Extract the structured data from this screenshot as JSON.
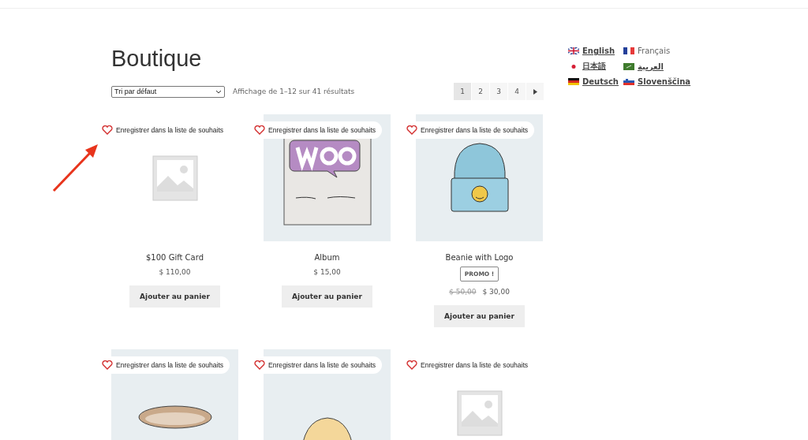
{
  "page_title": "Boutique",
  "sort": {
    "value": "Tri par défaut"
  },
  "result_count": "Affichage de 1–12 sur 41 résultats",
  "pagination": [
    {
      "label": "1",
      "selected": true
    },
    {
      "label": "2",
      "selected": false
    },
    {
      "label": "3",
      "selected": false
    },
    {
      "label": "4",
      "selected": false
    }
  ],
  "languages": [
    {
      "label": "English",
      "kind": "uk",
      "selected": false
    },
    {
      "label": "Français",
      "kind": "fr",
      "selected": true
    },
    {
      "label": "日本語",
      "kind": "jp",
      "selected": false
    },
    {
      "label": "العربية",
      "kind": "sa",
      "selected": false
    },
    {
      "label": "Deutsch",
      "kind": "de",
      "selected": false
    },
    {
      "label": "Slovenščina",
      "kind": "si",
      "selected": false
    }
  ],
  "products": [
    {
      "wishlist": "Enregistrer dans la liste de souhaits",
      "kind": "placeholder",
      "name": "$100 Gift Card",
      "price": "$ 110,00",
      "button": "Ajouter au panier"
    },
    {
      "wishlist": "Enregistrer dans la liste de souhaits",
      "kind": "album",
      "name": "Album",
      "price": "$ 15,00",
      "button": "Ajouter au panier"
    },
    {
      "wishlist": "Enregistrer dans la liste de souhaits",
      "kind": "beanie",
      "name": "Beanie with Logo",
      "badge": "PROMO !",
      "old_price": "$ 50,00",
      "price": "$ 30,00",
      "button": "Ajouter au panier"
    },
    {
      "wishlist": "Enregistrer dans la liste de souhaits",
      "kind": "belt"
    },
    {
      "wishlist": "Enregistrer dans la liste de souhaits",
      "kind": "cap"
    },
    {
      "wishlist": "Enregistrer dans la liste de souhaits",
      "kind": "placeholder"
    }
  ]
}
